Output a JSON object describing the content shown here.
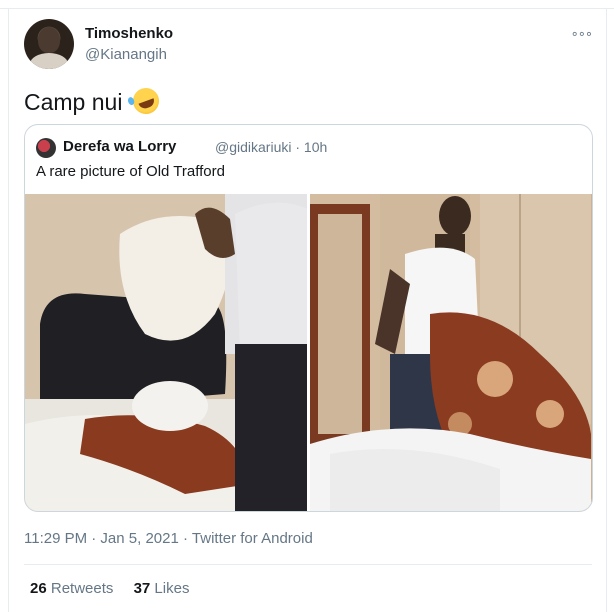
{
  "tweet": {
    "author_name": "Timoshenko",
    "author_handle": "@Kianangih",
    "text": "Camp nui",
    "emoji_icon": "rolling-on-floor-laughing-emoji",
    "timestamp": "11:29 PM · Jan 5, 2021",
    "source": "Twitter for Android",
    "retweets_count": "26",
    "retweets_label": "Retweets",
    "likes_count": "37",
    "likes_label": "Likes"
  },
  "quoted_tweet": {
    "author_name": "Derefa wa Lorry",
    "author_handle": "@gidikariuki",
    "separator": "·",
    "age": "10h",
    "text": "A rare picture of Old Trafford"
  },
  "colors": {
    "primary_text": "#14171a",
    "secondary_text": "#657786",
    "border": "#ccd6dd",
    "divider": "#e6ecf0"
  }
}
